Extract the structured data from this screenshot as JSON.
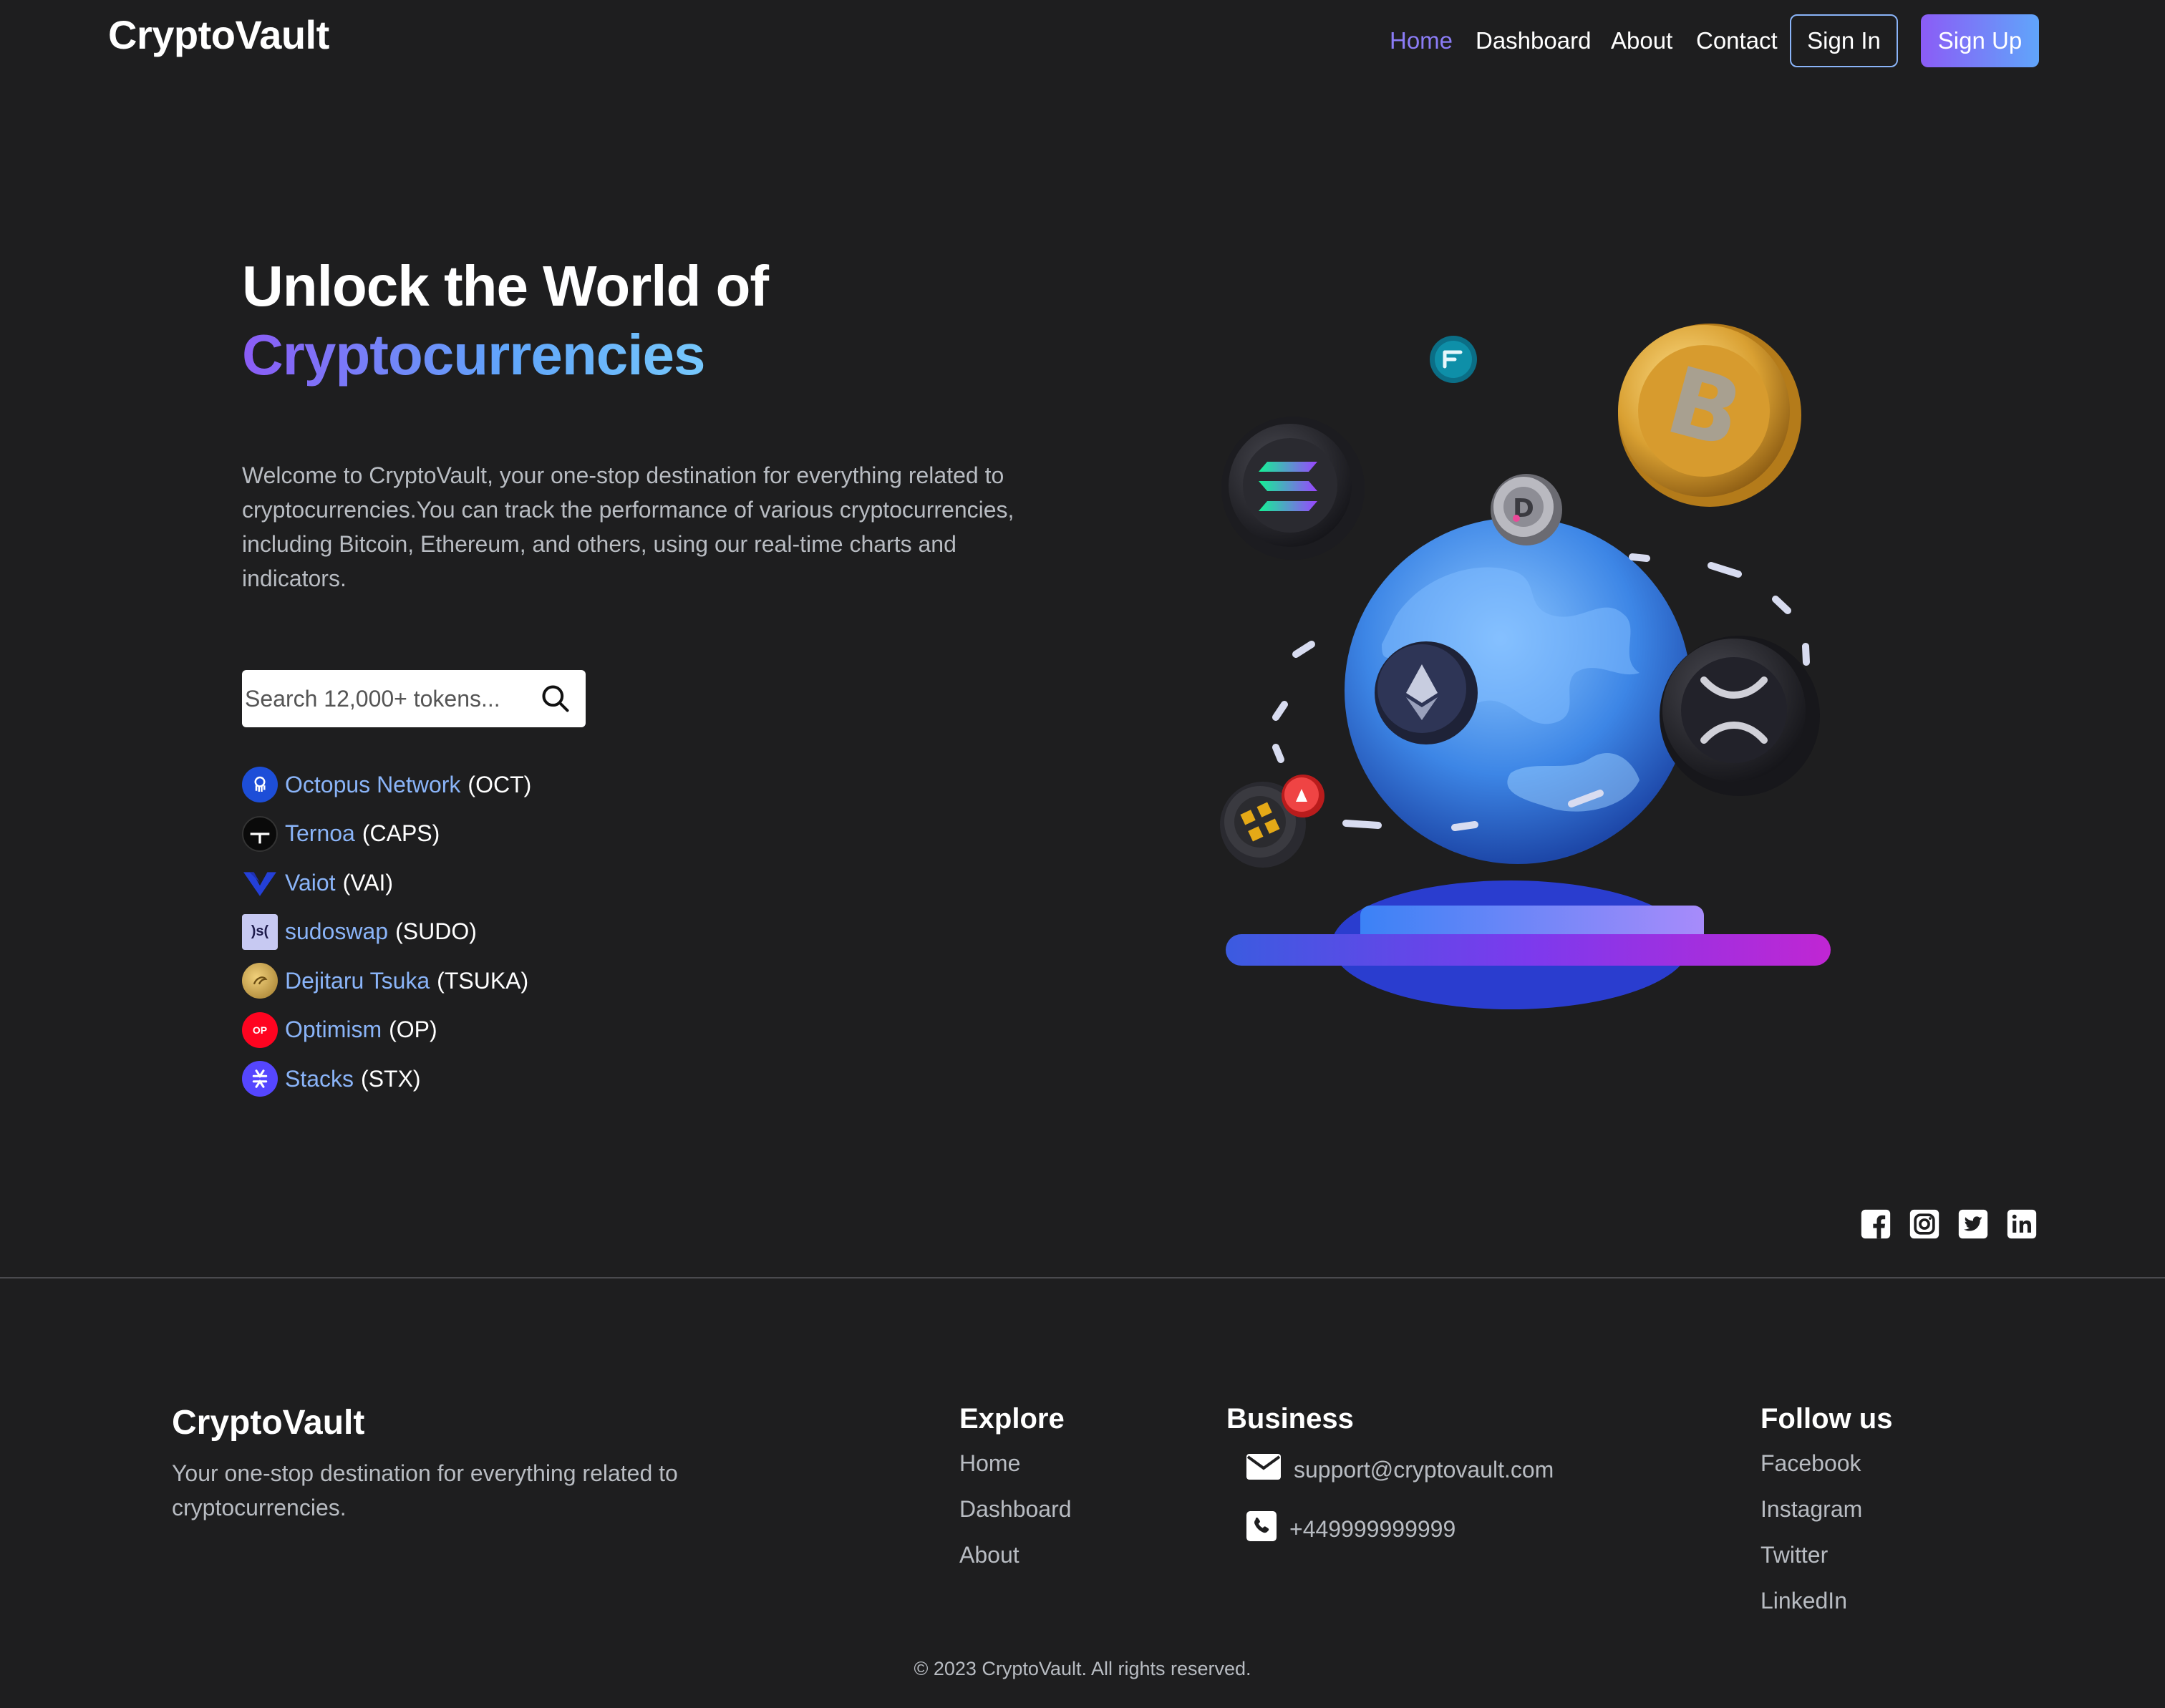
{
  "brand": "CryptoVault",
  "nav": {
    "links": [
      "Home",
      "Dashboard",
      "About",
      "Contact"
    ],
    "active": "Home",
    "sign_in": "Sign In",
    "sign_up": "Sign Up"
  },
  "hero": {
    "title_line1": "Unlock the World of",
    "title_line2": "Cryptocurrencies",
    "description": "Welcome to CryptoVault, your one-stop destination for everything related to cryptocurrencies.You can track the performance of various cryptocurrencies, including Bitcoin, Ethereum, and others, using our real-time charts and indicators.",
    "search_placeholder": "Search 12,000+ tokens..."
  },
  "tokens": [
    {
      "name": "Octopus Network",
      "symbol": "(OCT)",
      "color": "#1d4ed8"
    },
    {
      "name": "Ternoa",
      "symbol": "(CAPS)",
      "color": "#0a0a0a"
    },
    {
      "name": "Vaiot",
      "symbol": "(VAI)",
      "color": "#1e40af"
    },
    {
      "name": "sudoswap",
      "symbol": "(SUDO)",
      "color": "#c7c9f2"
    },
    {
      "name": "Dejitaru Tsuka",
      "symbol": "(TSUKA)",
      "color": "#c9a24e"
    },
    {
      "name": "Optimism",
      "symbol": "(OP)",
      "color": "#ff0420"
    },
    {
      "name": "Stacks",
      "symbol": "(STX)",
      "color": "#5546ff"
    }
  ],
  "social_icons": [
    "facebook-icon",
    "instagram-icon",
    "twitter-icon",
    "linkedin-icon"
  ],
  "footer": {
    "brand": "CryptoVault",
    "tagline": "Your one-stop destination for everything related to cryptocurrencies.",
    "explore": {
      "title": "Explore",
      "links": [
        "Home",
        "Dashboard",
        "About"
      ]
    },
    "business": {
      "title": "Business",
      "email": "support@cryptovault.com",
      "phone": "+449999999999"
    },
    "follow": {
      "title": "Follow us",
      "links": [
        "Facebook",
        "Instagram",
        "Twitter",
        "LinkedIn"
      ]
    },
    "copyright": "© 2023 CryptoVault. All rights reserved."
  }
}
